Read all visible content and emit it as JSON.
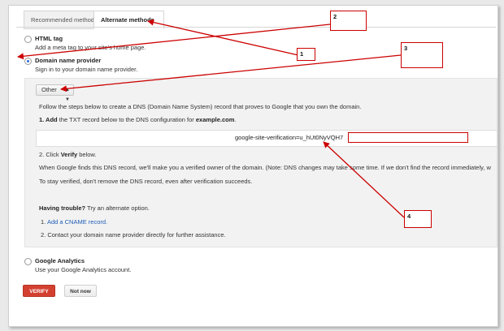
{
  "tabs": [
    {
      "label": "Recommended method",
      "active": false
    },
    {
      "label": "Alternate methods",
      "active": true
    }
  ],
  "options": {
    "html_tag": {
      "title": "HTML tag",
      "desc": "Add a meta tag to your site's home page."
    },
    "domain_provider": {
      "title": "Domain name provider",
      "desc": "Sign in to your domain name provider.",
      "selected": true
    },
    "google_analytics": {
      "title": "Google Analytics",
      "desc": "Use your Google Analytics account."
    }
  },
  "provider_select": {
    "value": "Other"
  },
  "instructions": {
    "intro": "Follow the steps below to create a DNS (Domain Name System) record that proves to Google that you own the domain.",
    "step1_prefix": "1. Add",
    "step1_middle": "the TXT record below to the DNS configuration for",
    "step1_domain": "example.com",
    "step1_suffix": ".",
    "txt_record": "google-site-verification=u_hUt0NyVQH7",
    "step2_prefix": "2. Click",
    "step2_verify": "Verify",
    "step2_suffix": "below.",
    "note1": "When Google finds this DNS record, we'll make you a verified owner of the domain. (Note: DNS changes may take some time. If we don't find the record immediately, w",
    "note2": "To stay verified, don't remove the DNS record, even after verification succeeds."
  },
  "trouble": {
    "heading": "Having trouble?",
    "heading_suffix": "Try an alternate option.",
    "item1_num": "1.",
    "item1_link": "Add a CNAME record.",
    "item2": "2.  Contact your domain name provider directly for further assistance."
  },
  "buttons": {
    "verify": "VERIFY",
    "not_now": "Not now"
  },
  "callouts": [
    "1",
    "2",
    "3",
    "4"
  ],
  "colors": {
    "annotation": "#cc0000",
    "verify": "#d44030",
    "link": "#1f5eb8"
  }
}
